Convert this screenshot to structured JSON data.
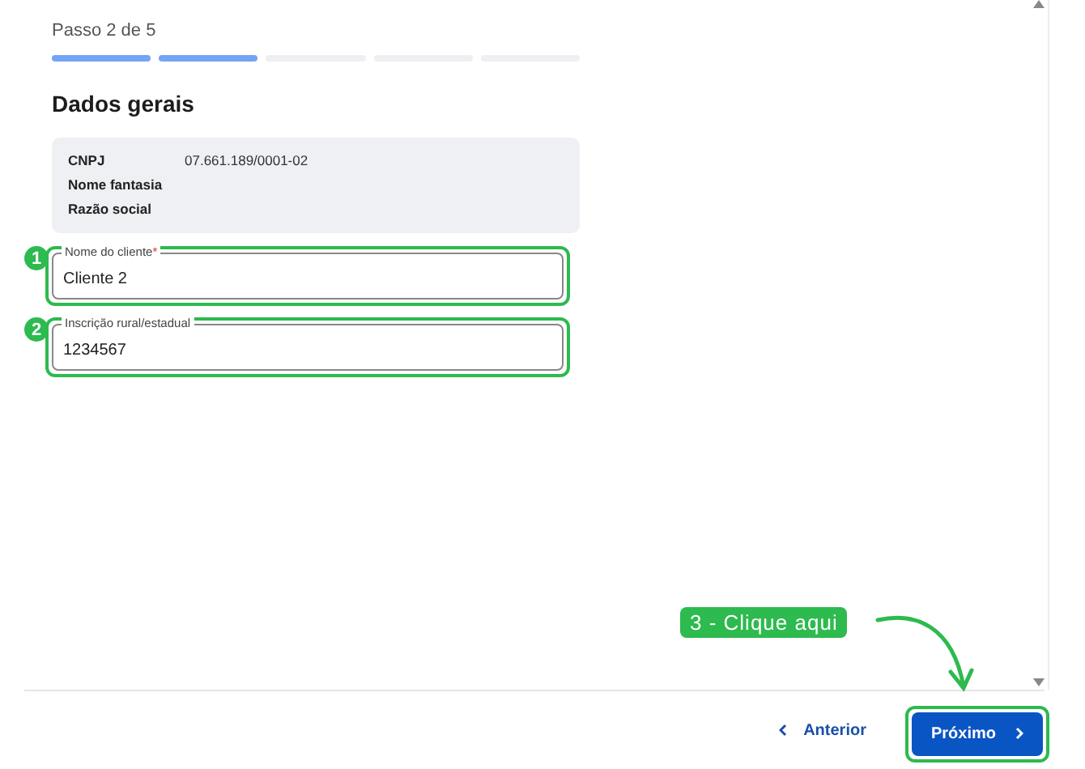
{
  "stepper": {
    "label": "Passo 2 de 5",
    "steps": [
      {
        "completed": true
      },
      {
        "completed": true
      },
      {
        "completed": false
      },
      {
        "completed": false
      },
      {
        "completed": false
      }
    ]
  },
  "section_title": "Dados gerais",
  "summary": [
    {
      "label": "CNPJ",
      "value": "07.661.189/0001-02"
    },
    {
      "label": "Nome fantasia"
    },
    {
      "label": "Razão social"
    }
  ],
  "fields": [
    {
      "marker": "1",
      "label": "Nome do cliente",
      "required_mark": "*",
      "value": "Cliente 2"
    },
    {
      "marker": "2",
      "label": "Inscrição rural/estadual",
      "value": "1234567"
    }
  ],
  "callout": {
    "text": "3 - Clique aqui"
  },
  "footer": {
    "back": "Anterior",
    "next": "Próximo"
  }
}
